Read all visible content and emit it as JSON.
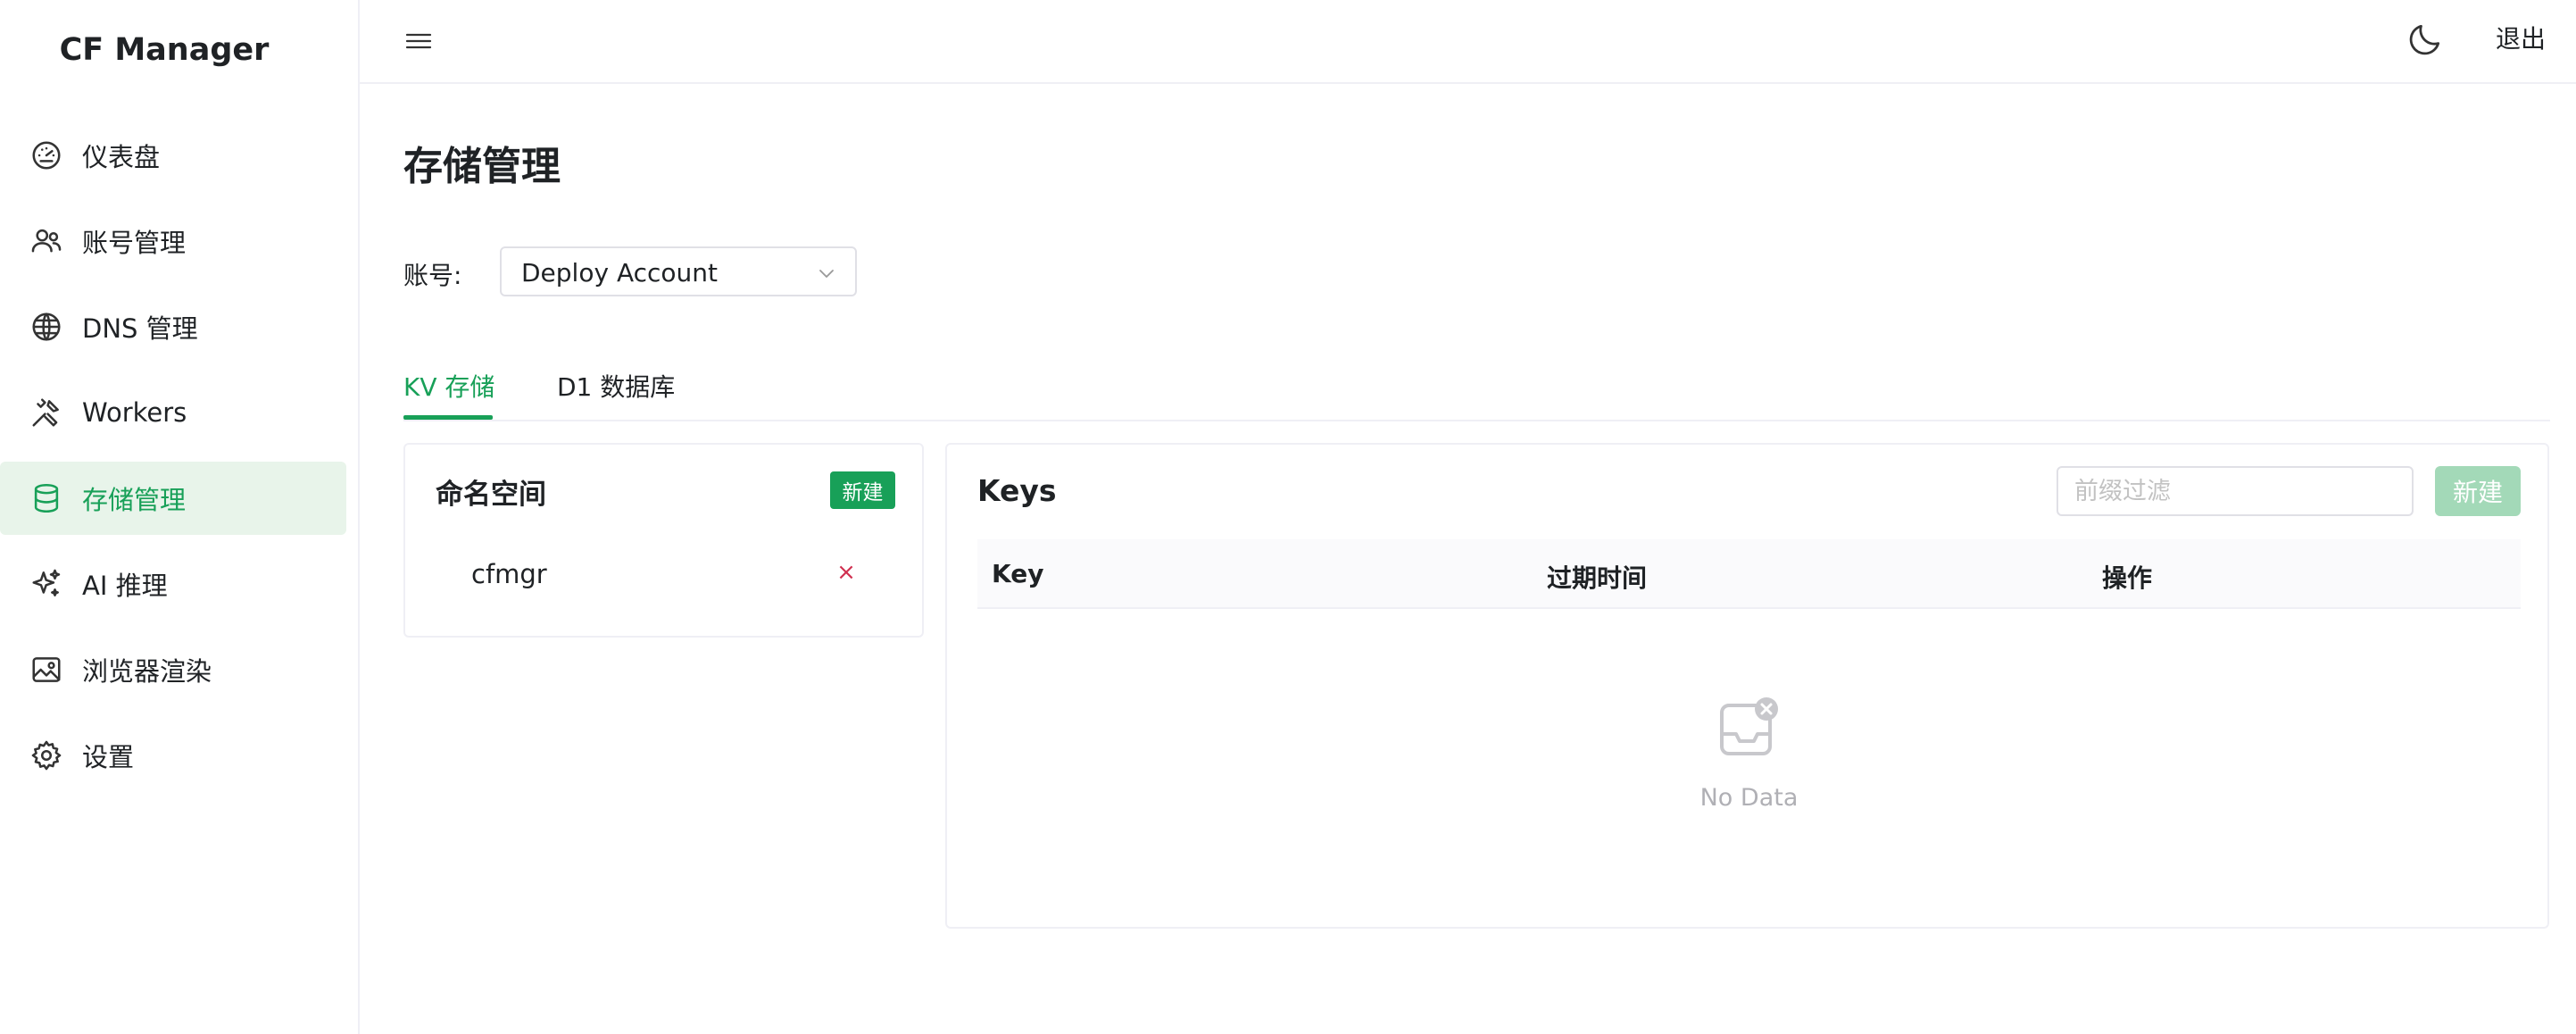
{
  "sidebar": {
    "brand": "CF Manager",
    "items": [
      {
        "label": "仪表盘",
        "icon": "dashboard-gauge-icon"
      },
      {
        "label": "账号管理",
        "icon": "users-icon"
      },
      {
        "label": "DNS 管理",
        "icon": "globe-icon"
      },
      {
        "label": "Workers",
        "icon": "tools-icon"
      },
      {
        "label": "存储管理",
        "icon": "database-icon",
        "active": true
      },
      {
        "label": "AI 推理",
        "icon": "sparkles-icon"
      },
      {
        "label": "浏览器渲染",
        "icon": "image-icon"
      },
      {
        "label": "设置",
        "icon": "gear-icon"
      }
    ]
  },
  "header": {
    "menu_icon": "hamburger-menu-icon",
    "theme_icon": "moon-icon",
    "logout_label": "退出"
  },
  "main": {
    "title": "存储管理",
    "account_label": "账号:",
    "account_value": "Deploy Account",
    "tabs": [
      {
        "label": "KV 存储",
        "active": true
      },
      {
        "label": "D1 数据库",
        "active": false
      }
    ]
  },
  "namespace_panel": {
    "title": "命名空间",
    "new_button": "新建",
    "items": [
      {
        "name": "cfmgr",
        "delete_label": "×"
      }
    ]
  },
  "keys_panel": {
    "title": "Keys",
    "filter_placeholder": "前缀过滤",
    "new_button": "新建",
    "columns": [
      "Key",
      "过期时间",
      "操作"
    ],
    "rows": [],
    "empty_text": "No Data"
  },
  "colors": {
    "accent": "#18a058",
    "accent_light_bg": "#e8f4ea",
    "disabled_button": "#a3d9b8",
    "danger": "#d03050",
    "border": "#efeff5"
  }
}
